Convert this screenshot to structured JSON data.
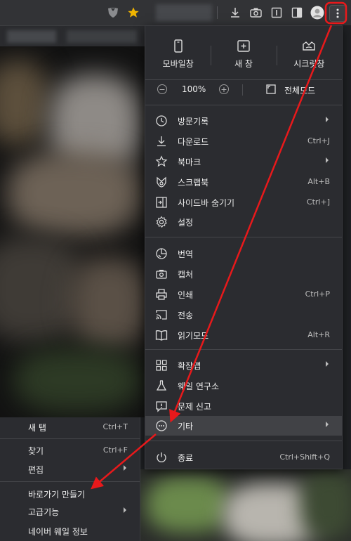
{
  "toolbar": {
    "icons": [
      "shield-icon",
      "star-icon",
      "download-icon",
      "camera-icon",
      "sidebar-panel-icon",
      "split-view-icon",
      "profile-avatar-icon",
      "more-menu-icon"
    ]
  },
  "menu": {
    "quick_actions": [
      {
        "label": "모바일창",
        "icon": "mobile-icon"
      },
      {
        "label": "새 창",
        "icon": "new-window-icon"
      },
      {
        "label": "시크릿창",
        "icon": "incognito-icon"
      }
    ],
    "zoom": {
      "minus": "−",
      "value": "100%",
      "plus": "+",
      "fullscreen_label": "전체모드"
    },
    "group1": [
      {
        "label": "방문기록",
        "shortcut": "",
        "submenu": true,
        "icon": "history-icon"
      },
      {
        "label": "다운로드",
        "shortcut": "Ctrl+J",
        "submenu": false,
        "icon": "download-icon"
      },
      {
        "label": "북마크",
        "shortcut": "",
        "submenu": true,
        "icon": "bookmark-star-icon"
      },
      {
        "label": "스크랩북",
        "shortcut": "Alt+B",
        "submenu": false,
        "icon": "scrapbook-icon"
      },
      {
        "label": "사이드바 숨기기",
        "shortcut": "Ctrl+]",
        "submenu": false,
        "icon": "sidebar-hide-icon"
      },
      {
        "label": "설정",
        "shortcut": "",
        "submenu": false,
        "icon": "settings-gear-icon"
      }
    ],
    "group2": [
      {
        "label": "번역",
        "shortcut": "",
        "submenu": false,
        "icon": "translate-icon"
      },
      {
        "label": "캡처",
        "shortcut": "",
        "submenu": false,
        "icon": "capture-camera-icon"
      },
      {
        "label": "인쇄",
        "shortcut": "Ctrl+P",
        "submenu": false,
        "icon": "print-icon"
      },
      {
        "label": "전송",
        "shortcut": "",
        "submenu": false,
        "icon": "cast-icon"
      },
      {
        "label": "읽기모드",
        "shortcut": "Alt+R",
        "submenu": false,
        "icon": "reading-mode-icon"
      }
    ],
    "group3": [
      {
        "label": "확장앱",
        "shortcut": "",
        "submenu": true,
        "icon": "extensions-grid-icon"
      },
      {
        "label": "웨일 연구소",
        "shortcut": "",
        "submenu": false,
        "icon": "lab-flask-icon"
      },
      {
        "label": "문제 신고",
        "shortcut": "",
        "submenu": false,
        "icon": "report-issue-icon"
      },
      {
        "label": "기타",
        "shortcut": "",
        "submenu": true,
        "icon": "more-circle-icon",
        "highlighted": true
      }
    ],
    "exit": {
      "label": "종료",
      "shortcut": "Ctrl+Shift+Q",
      "icon": "power-icon"
    }
  },
  "submenu": {
    "items": [
      {
        "label": "새 탭",
        "shortcut": "Ctrl+T",
        "submenu": false
      },
      {
        "label": "찾기",
        "shortcut": "Ctrl+F",
        "submenu": false
      },
      {
        "label": "편집",
        "shortcut": "",
        "submenu": true
      },
      {
        "label": "바로가기 만들기",
        "shortcut": "",
        "submenu": false
      },
      {
        "label": "고급기능",
        "shortcut": "",
        "submenu": true
      },
      {
        "label": "네이버 웨일 정보",
        "shortcut": "",
        "submenu": false
      }
    ]
  },
  "colors": {
    "accent_arrow": "#e8191b",
    "star": "#f0b400",
    "menu_bg": "#2b2c30",
    "highlight_bg": "#414246"
  }
}
